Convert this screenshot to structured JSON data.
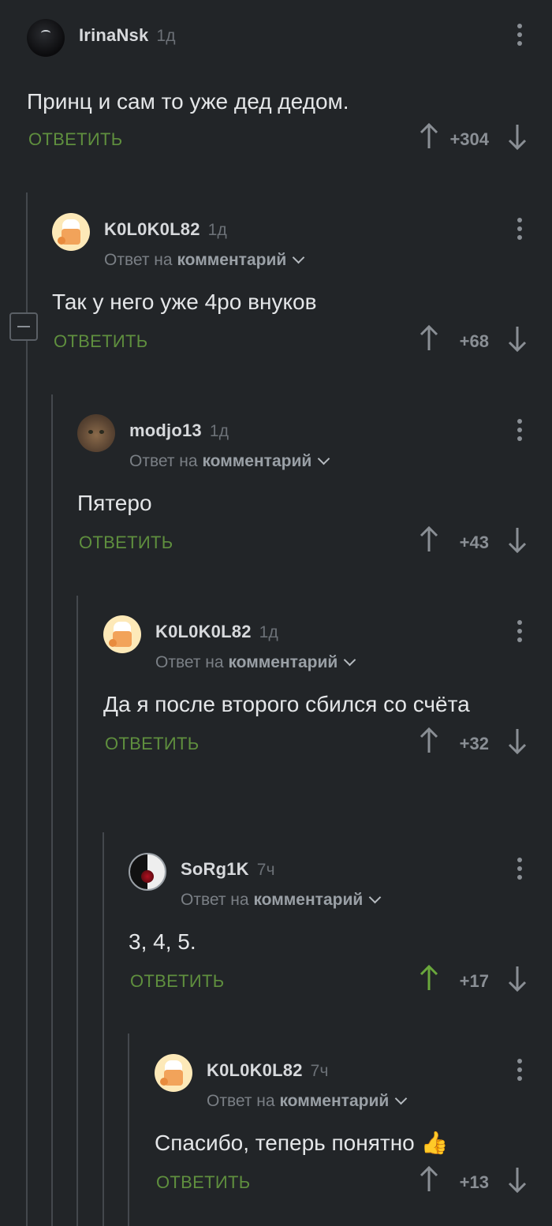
{
  "labels": {
    "reply": "ОТВЕТИТЬ",
    "reply_to_prefix": "Ответ на",
    "reply_to_target": "комментарий"
  },
  "comments": [
    {
      "user": "IrinaNsk",
      "time": "1д",
      "text": "Принц и сам то уже дед дедом.",
      "score": "+304",
      "avatar": "blackball-avatar",
      "upvoted": false
    },
    {
      "user": "K0L0K0L82",
      "time": "1д",
      "text": "Так у него уже 4ро внуков",
      "score": "+68",
      "avatar": "chef-avatar",
      "upvoted": false
    },
    {
      "user": "modjo13",
      "time": "1д",
      "text": "Пятеро",
      "score": "+43",
      "avatar": "cat-avatar",
      "upvoted": false
    },
    {
      "user": "K0L0K0L82",
      "time": "1д",
      "text": "Да я после второго сбился со счёта",
      "score": "+32",
      "avatar": "chef-avatar",
      "upvoted": false
    },
    {
      "user": "SoRg1K",
      "time": "7ч",
      "text": "3, 4, 5.",
      "score": "+17",
      "avatar": "yinyang-avatar",
      "upvoted": true
    },
    {
      "user": "K0L0K0L82",
      "time": "7ч",
      "text": "Спасибо, теперь понятно 👍",
      "score": "+13",
      "avatar": "chef-avatar",
      "upvoted": false
    }
  ],
  "colors": {
    "background": "#222528",
    "reply_green": "#5f8f3e",
    "upvote_active": "#6aa83c",
    "arrow_inactive": "#8a8f95"
  }
}
